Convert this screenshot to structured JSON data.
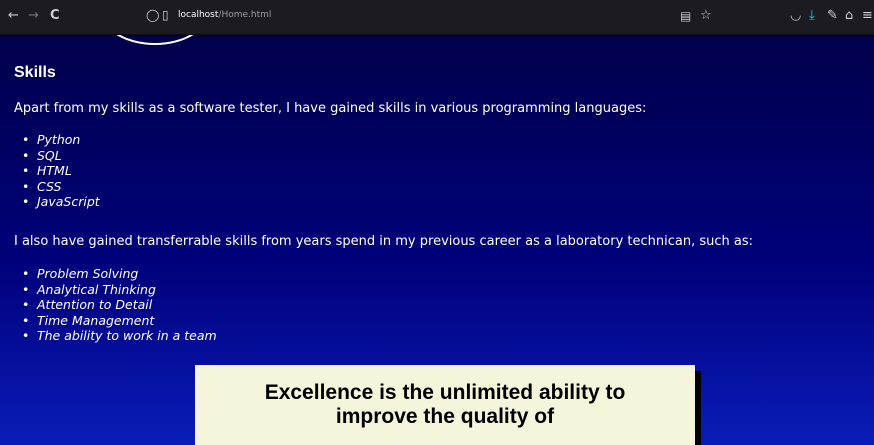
{
  "browser": {
    "back_icon": "←",
    "forward_icon": "→",
    "reload_icon": "C",
    "url_host": "localhost",
    "url_path": "/Home.html"
  },
  "page": {
    "skills_title": "Skills",
    "intro": "Apart from my skills as a software tester, I have gained skills in various programming languages:",
    "languages": [
      "Python",
      "SQL",
      "HTML",
      "CSS",
      "JavaScript"
    ],
    "transfer_intro": "I also have gained transferrable skills from years spend in my previous career as a laboratory technican, such as:",
    "transferable_skills": [
      "Problem Solving",
      "Analytical Thinking",
      "Attention to Detail",
      "Time Management",
      "The ability to work in a team"
    ],
    "quote": "Excellence is the unlimited ability to improve the quality of"
  }
}
